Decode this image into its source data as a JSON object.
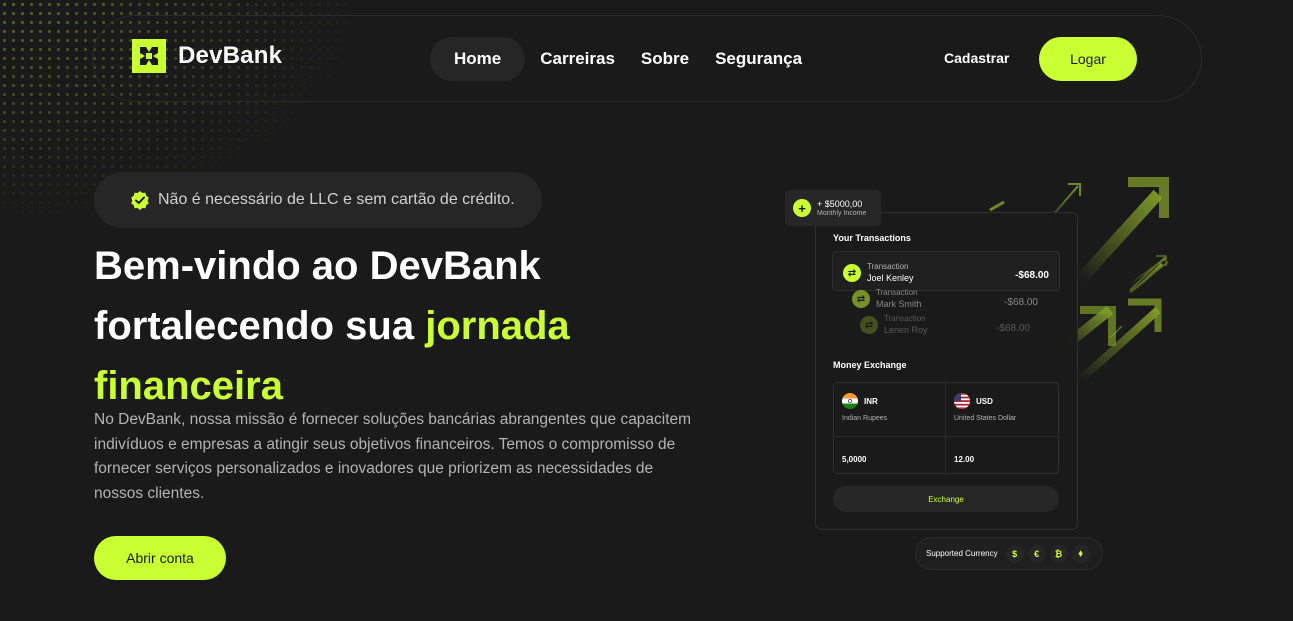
{
  "brand": {
    "name": "DevBank",
    "accent_color": "#caff33",
    "background_color": "#1a1a1a"
  },
  "nav": {
    "links": [
      {
        "label": "Home",
        "active": true
      },
      {
        "label": "Carreiras",
        "active": false
      },
      {
        "label": "Sobre",
        "active": false
      },
      {
        "label": "Segurança",
        "active": false
      }
    ],
    "register_label": "Cadastrar",
    "login_label": "Logar"
  },
  "hero": {
    "badge_text": "Não é necessário de LLC e sem cartão de crédito.",
    "title_line1": "Bem-vindo ao DevBank",
    "title_line2": "fortalecendo sua ",
    "title_accent1": "jornada",
    "title_accent2": "financeira",
    "description": "No DevBank, nossa missão é fornecer soluções bancárias abrangentes que capacitem indivíduos e empresas a atingir seus objetivos financeiros. Temos o compromisso de fornecer serviços personalizados e inovadores que priorizem as necessidades de nossos clientes.",
    "cta_label": "Abrir conta"
  },
  "card": {
    "income_amount": "+ $5000,00",
    "income_label": "Monthly Income",
    "transactions_title": "Your Transactions",
    "transactions": [
      {
        "label": "Transaction",
        "name": "Joel Kenley",
        "amount": "-$68.00"
      },
      {
        "label": "Transaction",
        "name": "Mark Smith",
        "amount": "-$68.00"
      },
      {
        "label": "Transaction",
        "name": "Lenen Roy",
        "amount": "-$68.00"
      }
    ],
    "exchange_title": "Money Exchange",
    "exchange": {
      "from": {
        "code": "INR",
        "name": "Indian Rupees",
        "value": "5,0000"
      },
      "to": {
        "code": "USD",
        "name": "United States Dollar",
        "value": "12.00"
      }
    },
    "exchange_button": "Exchange",
    "supported_label": "Supported Currency",
    "supported_icons": [
      "$",
      "€",
      "₿",
      "⬧"
    ]
  }
}
